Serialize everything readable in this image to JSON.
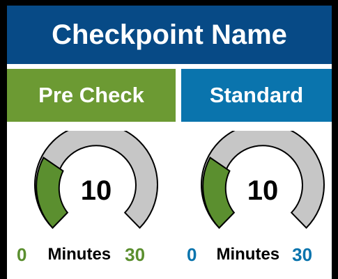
{
  "colors": {
    "title_bg": "#074a86",
    "precheck_bg": "#6c9a33",
    "standard_bg": "#0a74ad",
    "gauge_track": "#c6c6c6",
    "gauge_green": "#5b8f2f",
    "text_blue": "#0a74ad",
    "text_green": "#5b8f2f"
  },
  "header": {
    "title": "Checkpoint Name"
  },
  "tabs": [
    {
      "label": "Pre Check"
    },
    {
      "label": "Standard"
    }
  ],
  "gauges": [
    {
      "value": "10",
      "min_label": "0",
      "max_label": "30",
      "unit": "Minutes",
      "value_num": 10,
      "min": 0,
      "max": 30
    },
    {
      "value": "10",
      "min_label": "0",
      "max_label": "30",
      "unit": "Minutes",
      "value_num": 10,
      "min": 0,
      "max": 30
    }
  ]
}
